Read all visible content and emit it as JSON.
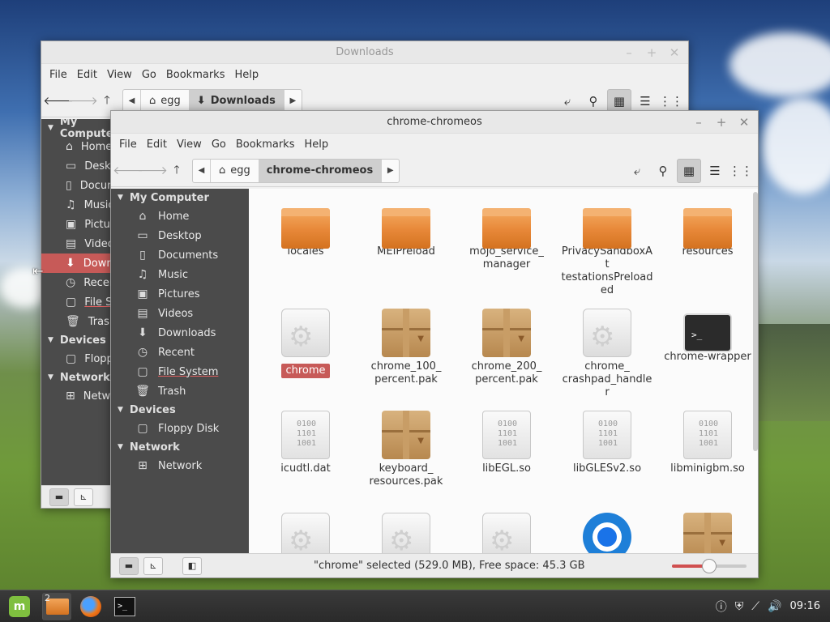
{
  "desktop": {
    "taskbar": {
      "workspace_badge": "2",
      "mint_glyph": "m",
      "terminal_glyph": ">_",
      "clock": "09:16",
      "tray_icons": [
        "info-icon",
        "shield-icon",
        "network-icon",
        "volume-icon"
      ]
    }
  },
  "back_window": {
    "title": "Downloads",
    "menu": [
      "File",
      "Edit",
      "View",
      "Go",
      "Bookmarks",
      "Help"
    ],
    "crumbs": [
      "egg",
      "Downloads"
    ],
    "sidebar": {
      "my_computer": "My Computer",
      "items": [
        "Home",
        "Desktop",
        "Documents",
        "Music",
        "Pictures",
        "Videos",
        "Downloads",
        "Recent",
        "File System",
        "Trash"
      ],
      "devices": "Devices",
      "device_items": [
        "Floppy Disk"
      ],
      "network": "Network",
      "network_items": [
        "Network"
      ]
    }
  },
  "front_window": {
    "title": "chrome-chromeos",
    "menu": [
      "File",
      "Edit",
      "View",
      "Go",
      "Bookmarks",
      "Help"
    ],
    "crumbs": [
      "egg",
      "chrome-chromeos"
    ],
    "sidebar": {
      "my_computer": "My Computer",
      "items": [
        "Home",
        "Desktop",
        "Documents",
        "Music",
        "Pictures",
        "Videos",
        "Downloads",
        "Recent",
        "File System",
        "Trash"
      ],
      "devices": "Devices",
      "device_items": [
        "Floppy Disk"
      ],
      "network": "Network",
      "network_items": [
        "Network"
      ]
    },
    "files": [
      {
        "name": "locales",
        "kind": "folder"
      },
      {
        "name": "MEIPreload",
        "kind": "folder"
      },
      {
        "name": "mojo_service_\nmanager",
        "kind": "folder"
      },
      {
        "name": "PrivacySandboxAt\ntestationsPreload\ned",
        "kind": "folder"
      },
      {
        "name": "resources",
        "kind": "folder"
      },
      {
        "name": "chrome",
        "kind": "app",
        "selected": true
      },
      {
        "name": "chrome_100_\npercent.pak",
        "kind": "package"
      },
      {
        "name": "chrome_200_\npercent.pak",
        "kind": "package"
      },
      {
        "name": "chrome_\ncrashpad_handler",
        "kind": "app"
      },
      {
        "name": "chrome-wrapper",
        "kind": "terminal"
      },
      {
        "name": "icudtl.dat",
        "kind": "binary"
      },
      {
        "name": "keyboard_\nresources.pak",
        "kind": "package"
      },
      {
        "name": "libEGL.so",
        "kind": "binary"
      },
      {
        "name": "libGLESv2.so",
        "kind": "binary"
      },
      {
        "name": "libminigbm.so",
        "kind": "binary"
      },
      {
        "name": "",
        "kind": "app"
      },
      {
        "name": "",
        "kind": "app"
      },
      {
        "name": "",
        "kind": "app"
      },
      {
        "name": "",
        "kind": "chrome-logo"
      },
      {
        "name": "",
        "kind": "package"
      }
    ],
    "binary_bits": "0100\n1101\n1001",
    "status": "\"chrome\" selected (529.0 MB), Free space: 45.3 GB",
    "zoom_level": 0.5
  }
}
